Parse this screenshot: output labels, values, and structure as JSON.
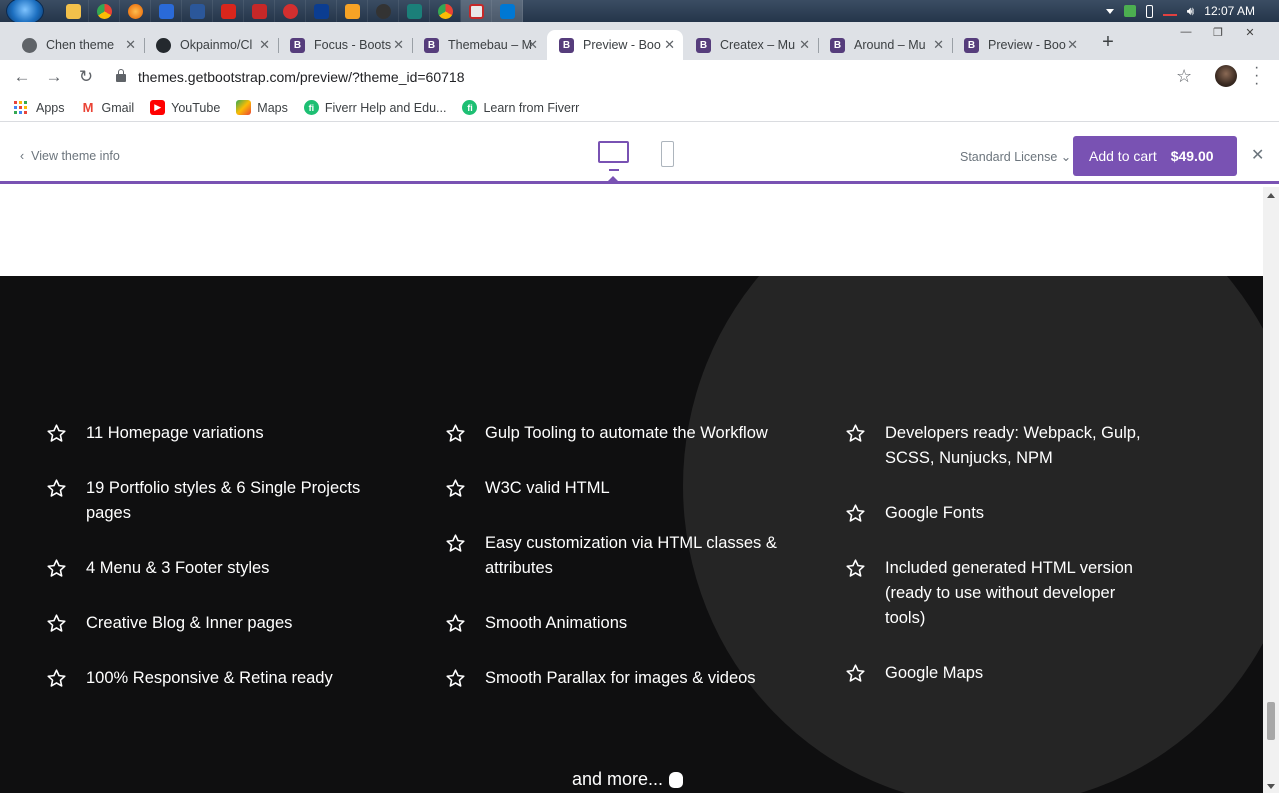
{
  "taskbar": {
    "clock": "12:07 AM",
    "apps": [
      "file-explorer",
      "chrome",
      "firefox",
      "app",
      "word",
      "acrobat",
      "adobe-app",
      "app",
      "photoshop",
      "media-player",
      "app",
      "app",
      "chrome",
      "app",
      "vscode"
    ]
  },
  "browser": {
    "tabs": [
      {
        "title": "Chen theme",
        "favicon": "chrome-icon"
      },
      {
        "title": "Okpainmo/Cl",
        "favicon": "github-icon"
      },
      {
        "title": "Focus - Boots",
        "favicon": "bootstrap-icon"
      },
      {
        "title": "Themebau – M",
        "favicon": "bootstrap-icon"
      },
      {
        "title": "Preview - Boo",
        "favicon": "bootstrap-icon"
      },
      {
        "title": "Createx – Mu",
        "favicon": "bootstrap-icon"
      },
      {
        "title": "Around – Mu",
        "favicon": "bootstrap-icon"
      },
      {
        "title": "Preview - Boo",
        "favicon": "bootstrap-icon"
      }
    ],
    "url": "themes.getbootstrap.com/preview/?theme_id=60718",
    "bookmarks": [
      "Apps",
      "Gmail",
      "YouTube",
      "Maps",
      "Fiverr Help and Edu...",
      "Learn from Fiverr"
    ]
  },
  "preview": {
    "view_info": "View theme info",
    "license": "Standard License",
    "cart_label": "Add to cart",
    "price": "$49.00"
  },
  "features": {
    "col1": [
      "11 Homepage variations",
      "19 Portfolio styles & 6 Single Projects pages",
      "4 Menu & 3 Footer styles",
      "Creative Blog & Inner pages",
      "100% Responsive & Retina ready"
    ],
    "col2": [
      "Gulp Tooling to automate the Workflow",
      "W3C valid HTML",
      "Easy customization via HTML classes & attributes",
      "Smooth Animations",
      "Smooth Parallax for images & videos"
    ],
    "col3": [
      "Developers ready: Webpack, Gulp, SCSS, Nunjucks, NPM",
      "Google Fonts",
      "Included generated HTML version (ready to use without developer tools)",
      "Google Maps"
    ],
    "more": "and more..."
  },
  "colors": {
    "accent": "#7952b3",
    "dark_bg": "#0f0f10",
    "circle": "#252525"
  }
}
